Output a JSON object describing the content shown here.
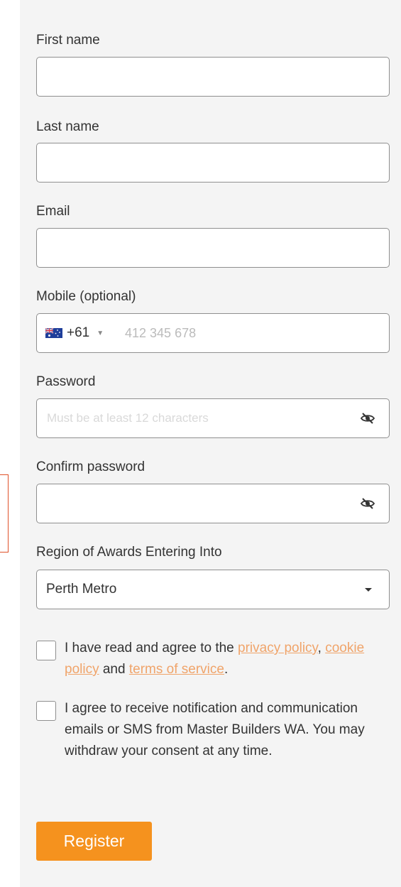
{
  "form": {
    "first_name": {
      "label": "First name",
      "value": "",
      "placeholder": ""
    },
    "last_name": {
      "label": "Last name",
      "value": "",
      "placeholder": ""
    },
    "email": {
      "label": "Email",
      "value": "",
      "placeholder": ""
    },
    "mobile": {
      "label": "Mobile (optional)",
      "country_flag": "australia-flag",
      "dial_code": "+61",
      "value": "",
      "placeholder": "412 345 678"
    },
    "password": {
      "label": "Password",
      "value": "",
      "placeholder": "Must be at least 12 characters",
      "toggle_icon": "eye-slash-icon"
    },
    "confirm_password": {
      "label": "Confirm password",
      "value": "",
      "placeholder": "",
      "toggle_icon": "eye-slash-icon"
    },
    "region": {
      "label": "Region of Awards Entering Into",
      "selected": "Perth Metro",
      "caret_icon": "caret-down-icon"
    },
    "agree_terms": {
      "checked": false,
      "text_before": "I have read and agree to the ",
      "privacy_link": "privacy policy",
      "sep1": ", ",
      "cookie_link": "cookie policy",
      "sep2": " and ",
      "terms_link": "terms of service",
      "text_after": "."
    },
    "agree_comms": {
      "checked": false,
      "text": "I agree to receive notification and communication emails or SMS from Master Builders WA. You may withdraw your consent at any time."
    },
    "register_label": "Register"
  },
  "colors": {
    "panel_bg": "#f4f4f4",
    "border": "#8f8f8f",
    "link": "#f0a46a",
    "button": "#f5921e",
    "bracket": "#e0522a"
  }
}
